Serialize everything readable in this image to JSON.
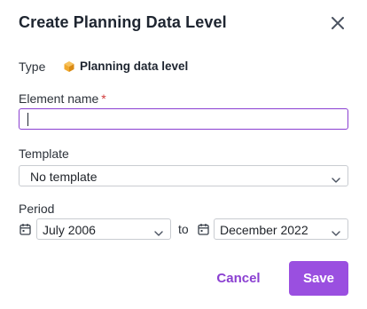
{
  "dialog": {
    "title": "Create Planning Data Level",
    "close_icon": "close-icon"
  },
  "type": {
    "label": "Type",
    "value": "Planning data level",
    "icon": "cube-icon",
    "icon_color": "#f0a92e"
  },
  "element_name": {
    "label": "Element name",
    "required_mark": "*",
    "value": ""
  },
  "template": {
    "label": "Template",
    "selected": "No template"
  },
  "period": {
    "label": "Period",
    "from": "July 2006",
    "separator": "to",
    "until": "December 2022"
  },
  "actions": {
    "cancel_label": "Cancel",
    "save_label": "Save"
  },
  "colors": {
    "accent": "#9a4fe0",
    "accent_text": "#8a3fd1",
    "required": "#d13b3b"
  }
}
